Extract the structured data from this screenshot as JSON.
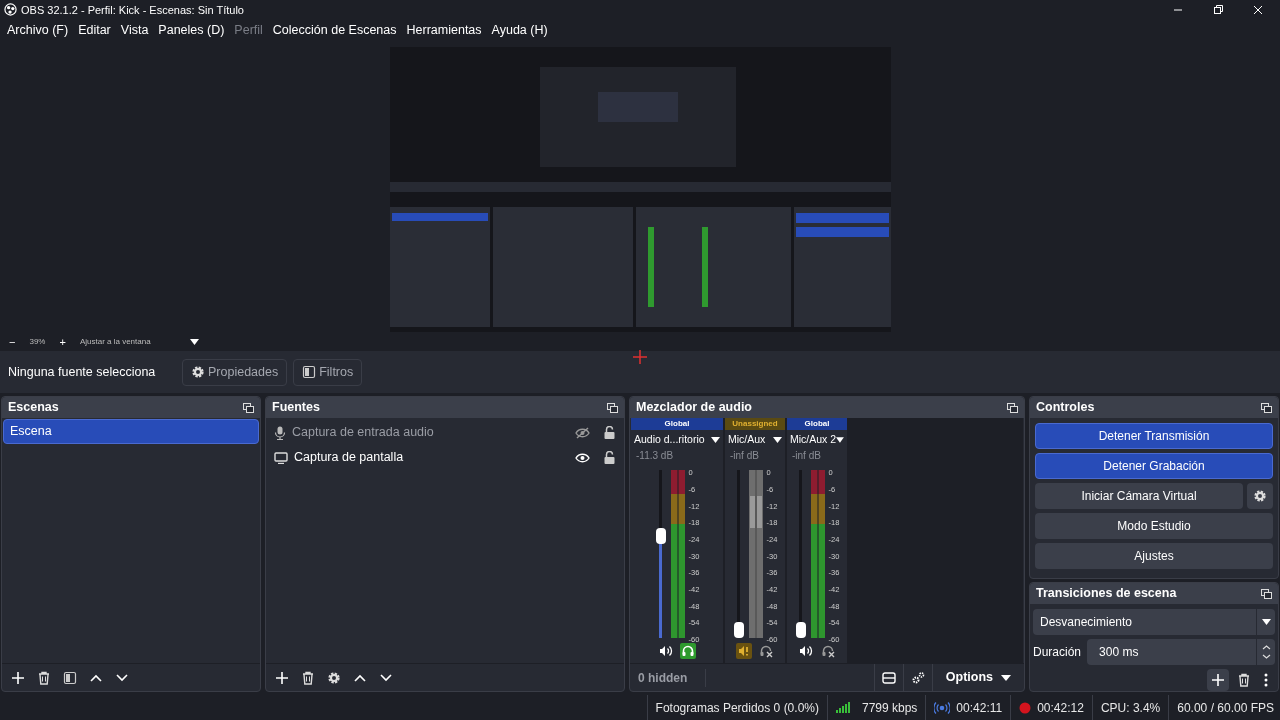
{
  "window": {
    "title": "OBS 32.1.2 - Perfil: Kick - Escenas: Sin Título"
  },
  "menu": [
    {
      "label": "Archivo (F)",
      "disabled": false
    },
    {
      "label": "Editar",
      "disabled": false
    },
    {
      "label": "Vista",
      "disabled": false
    },
    {
      "label": "Paneles (D)",
      "disabled": false
    },
    {
      "label": "Perfil",
      "disabled": true
    },
    {
      "label": "Colección de Escenas",
      "disabled": false
    },
    {
      "label": "Herramientas",
      "disabled": false
    },
    {
      "label": "Ayuda (H)",
      "disabled": false
    }
  ],
  "preview": {
    "zoom_out": "−",
    "zoom": "39%",
    "zoom_in": "+",
    "fit": "Ajustar a la ventana"
  },
  "source_bar": {
    "status": "Ninguna fuente selecciona",
    "buttons": [
      {
        "label": "Propiedades",
        "kind": "properties",
        "disabled": true
      },
      {
        "label": "Filtros",
        "kind": "filters",
        "disabled": true
      }
    ]
  },
  "scenes": {
    "title": "Escenas",
    "items": [
      {
        "label": "Escena",
        "selected": true
      }
    ]
  },
  "sources": {
    "title": "Fuentes",
    "items": [
      {
        "label": "Captura de entrada audio",
        "kind": "mic",
        "visible": false
      },
      {
        "label": "Captura de pantalla",
        "kind": "display",
        "visible": true
      }
    ]
  },
  "mixer": {
    "title": "Mezclador de audio",
    "channels": [
      {
        "group": "Global",
        "color": "#1d3c96",
        "name": "Audio d...ritorio",
        "reading": "-11.3 dB",
        "level": 0.62,
        "muted": false,
        "monitoring": true,
        "scale": [
          "0",
          "-6",
          "-12",
          "-18",
          "-24",
          "-30",
          "-36",
          "-42",
          "-48",
          "-54",
          "-60"
        ]
      },
      {
        "group": "Unassigned",
        "color": "#5a4a12",
        "name": "Mic/Aux",
        "reading": "-inf dB",
        "level": 0,
        "muted": true,
        "monitoring": false,
        "scale": [
          "0",
          "-6",
          "-12",
          "-18",
          "-24",
          "-30",
          "-36",
          "-42",
          "-48",
          "-54",
          "-60"
        ]
      },
      {
        "group": "Global",
        "color": "#1d3c96",
        "name": "Mic/Aux 2",
        "reading": "-inf dB",
        "level": 0,
        "muted": false,
        "monitoring": false,
        "scale": [
          "0",
          "-6",
          "-12",
          "-18",
          "-24",
          "-30",
          "-36",
          "-42",
          "-48",
          "-54",
          "-60"
        ]
      }
    ],
    "hidden_count": "0 hidden",
    "options": "Options"
  },
  "controls": {
    "title": "Controles",
    "buttons": [
      {
        "label": "Detener Transmisión",
        "active": true,
        "kind": "plain"
      },
      {
        "label": "Detener Grabación",
        "active": true,
        "kind": "plain"
      },
      {
        "label": "Iniciar Cámara Virtual",
        "active": false,
        "kind": "with_settings"
      },
      {
        "label": "Modo Estudio",
        "active": false,
        "kind": "plain"
      },
      {
        "label": "Ajustes",
        "active": false,
        "kind": "plain"
      }
    ]
  },
  "transitions": {
    "title": "Transiciones de escena",
    "selected": "Desvanecimiento",
    "duration_label": "Duración",
    "duration": "300 ms"
  },
  "status_bar": {
    "dropped_frames": "Fotogramas Perdidos 0 (0.0%)",
    "bitrate": "7799 kbps",
    "stream_time": "00:42:11",
    "record_time": "00:42:12",
    "cpu": "CPU: 3.4%",
    "fps": "60.00 / 60.00 FPS"
  }
}
